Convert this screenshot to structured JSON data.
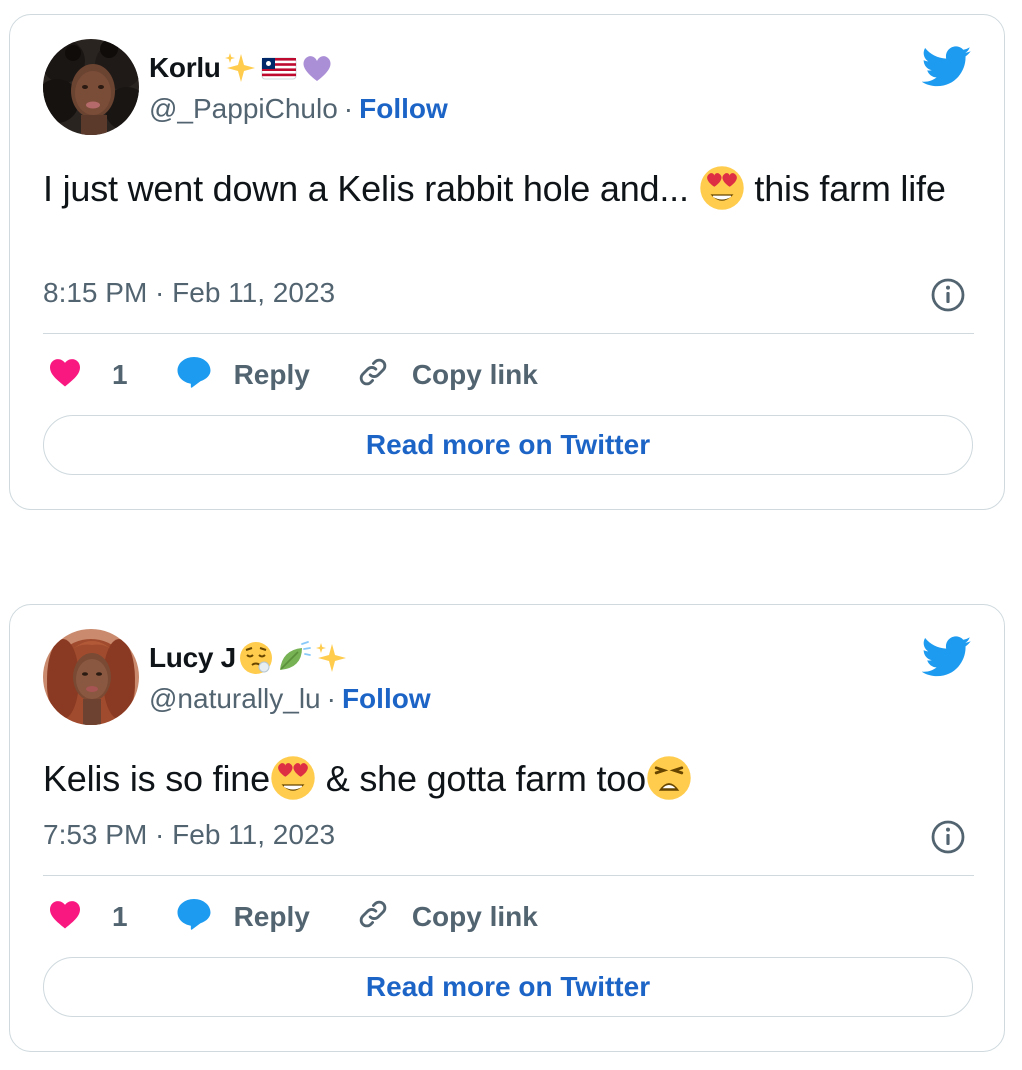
{
  "tweets": [
    {
      "author_name": "Korlu",
      "name_emojis": [
        "sparkles-emoji",
        "liberia-flag-emoji",
        "purple-heart-emoji"
      ],
      "handle": "@_PappiChulo",
      "separator": "·",
      "follow_label": "Follow",
      "text_part1": "I just went down a Kelis rabbit hole and...",
      "text_emoji": "heart-eyes-emoji",
      "text_part2": "this farm life",
      "timestamp": "8:15 PM · Feb 11, 2023",
      "like_count": "1",
      "reply_label": "Reply",
      "copy_link_label": "Copy link",
      "read_more_label": "Read more on Twitter"
    },
    {
      "author_name": "Lucy J",
      "name_emojis": [
        "relieved-sleepy-emoji",
        "leaf-fluttering-emoji",
        "sparkles-emoji"
      ],
      "handle": "@naturally_lu",
      "separator": "·",
      "follow_label": "Follow",
      "text_part1": "Kelis is so fine",
      "text_emoji": "heart-eyes-emoji",
      "text_part2": "& she gotta farm too",
      "text_emoji2": "weary-face-emoji",
      "timestamp": "7:53 PM · Feb 11, 2023",
      "like_count": "1",
      "reply_label": "Reply",
      "copy_link_label": "Copy link",
      "read_more_label": "Read more on Twitter"
    }
  ],
  "colors": {
    "twitter_blue": "#1d9bf0",
    "link_blue": "#1d64c7",
    "like_pink": "#f91880",
    "muted_text": "#536471",
    "border": "#cfd9de"
  }
}
